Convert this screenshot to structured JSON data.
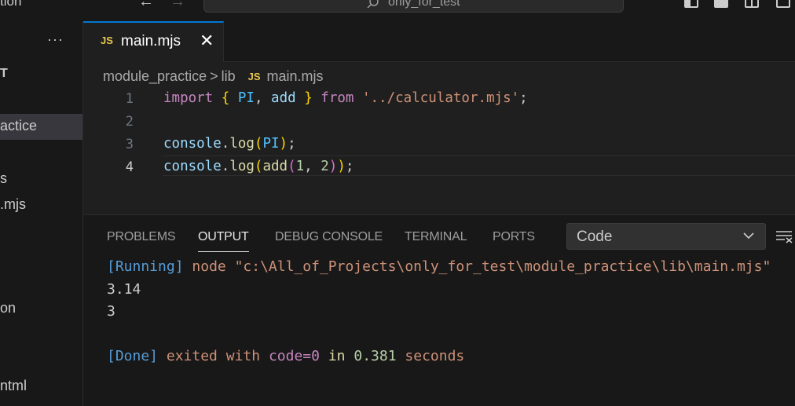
{
  "titlebar": {
    "title_fragment": "tion",
    "more": "···",
    "back": "←",
    "forward": "→",
    "search_text": "only_for_test"
  },
  "sidebar": {
    "more": "···",
    "items": [
      {
        "label": "T"
      },
      {
        "label": "actice"
      },
      {
        "label": "s"
      },
      {
        "label": ".mjs"
      },
      {
        "label": "on"
      },
      {
        "label": "ntml"
      }
    ]
  },
  "tab": {
    "icon_text": "JS",
    "label": "main.mjs",
    "close": "✕"
  },
  "breadcrumb": {
    "items": [
      "module_practice",
      "lib",
      "main.mjs"
    ],
    "separator": ">",
    "icon_text": "JS"
  },
  "editor": {
    "line_numbers": [
      "1",
      "2",
      "3",
      "4"
    ],
    "active_line": "4",
    "line1": {
      "kw_import": "import",
      "brace_open": "{",
      "pi": "PI",
      "comma": ",",
      "add": "add",
      "brace_close": "}",
      "kw_from": "from",
      "path": "'../calculator.mjs'",
      "semi": ";"
    },
    "line3": {
      "console": "console",
      "dot": ".",
      "log": "log",
      "paren_open": "(",
      "pi": "PI",
      "paren_close": ")",
      "semi": ";"
    },
    "line4": {
      "console": "console",
      "dot": ".",
      "log": "log",
      "paren_open": "(",
      "add": "add",
      "inner_open": "(",
      "arg1": "1",
      "comma": ", ",
      "arg2": "2",
      "inner_close": ")",
      "paren_close": ")",
      "semi": ";"
    }
  },
  "panel": {
    "tabs": [
      "PROBLEMS",
      "OUTPUT",
      "DEBUG CONSOLE",
      "TERMINAL",
      "PORTS"
    ],
    "active_tab": "OUTPUT",
    "dropdown_value": "Code",
    "output": {
      "running_tag": "[Running]",
      "command": "node \"c:\\All_of_Projects\\only_for_test\\module_practice\\lib\\main.mjs\"",
      "line2": "3.14",
      "line3": "3",
      "done_tag": "[Done]",
      "exited": "exited",
      "with": "with",
      "code": "code=0",
      "in": "in",
      "time": "0.381",
      "seconds": "seconds"
    }
  },
  "colors": {
    "accent": "#0078d4",
    "background": "#1f1f1f",
    "panel_background": "#181818",
    "js_icon": "#e8c74a"
  }
}
